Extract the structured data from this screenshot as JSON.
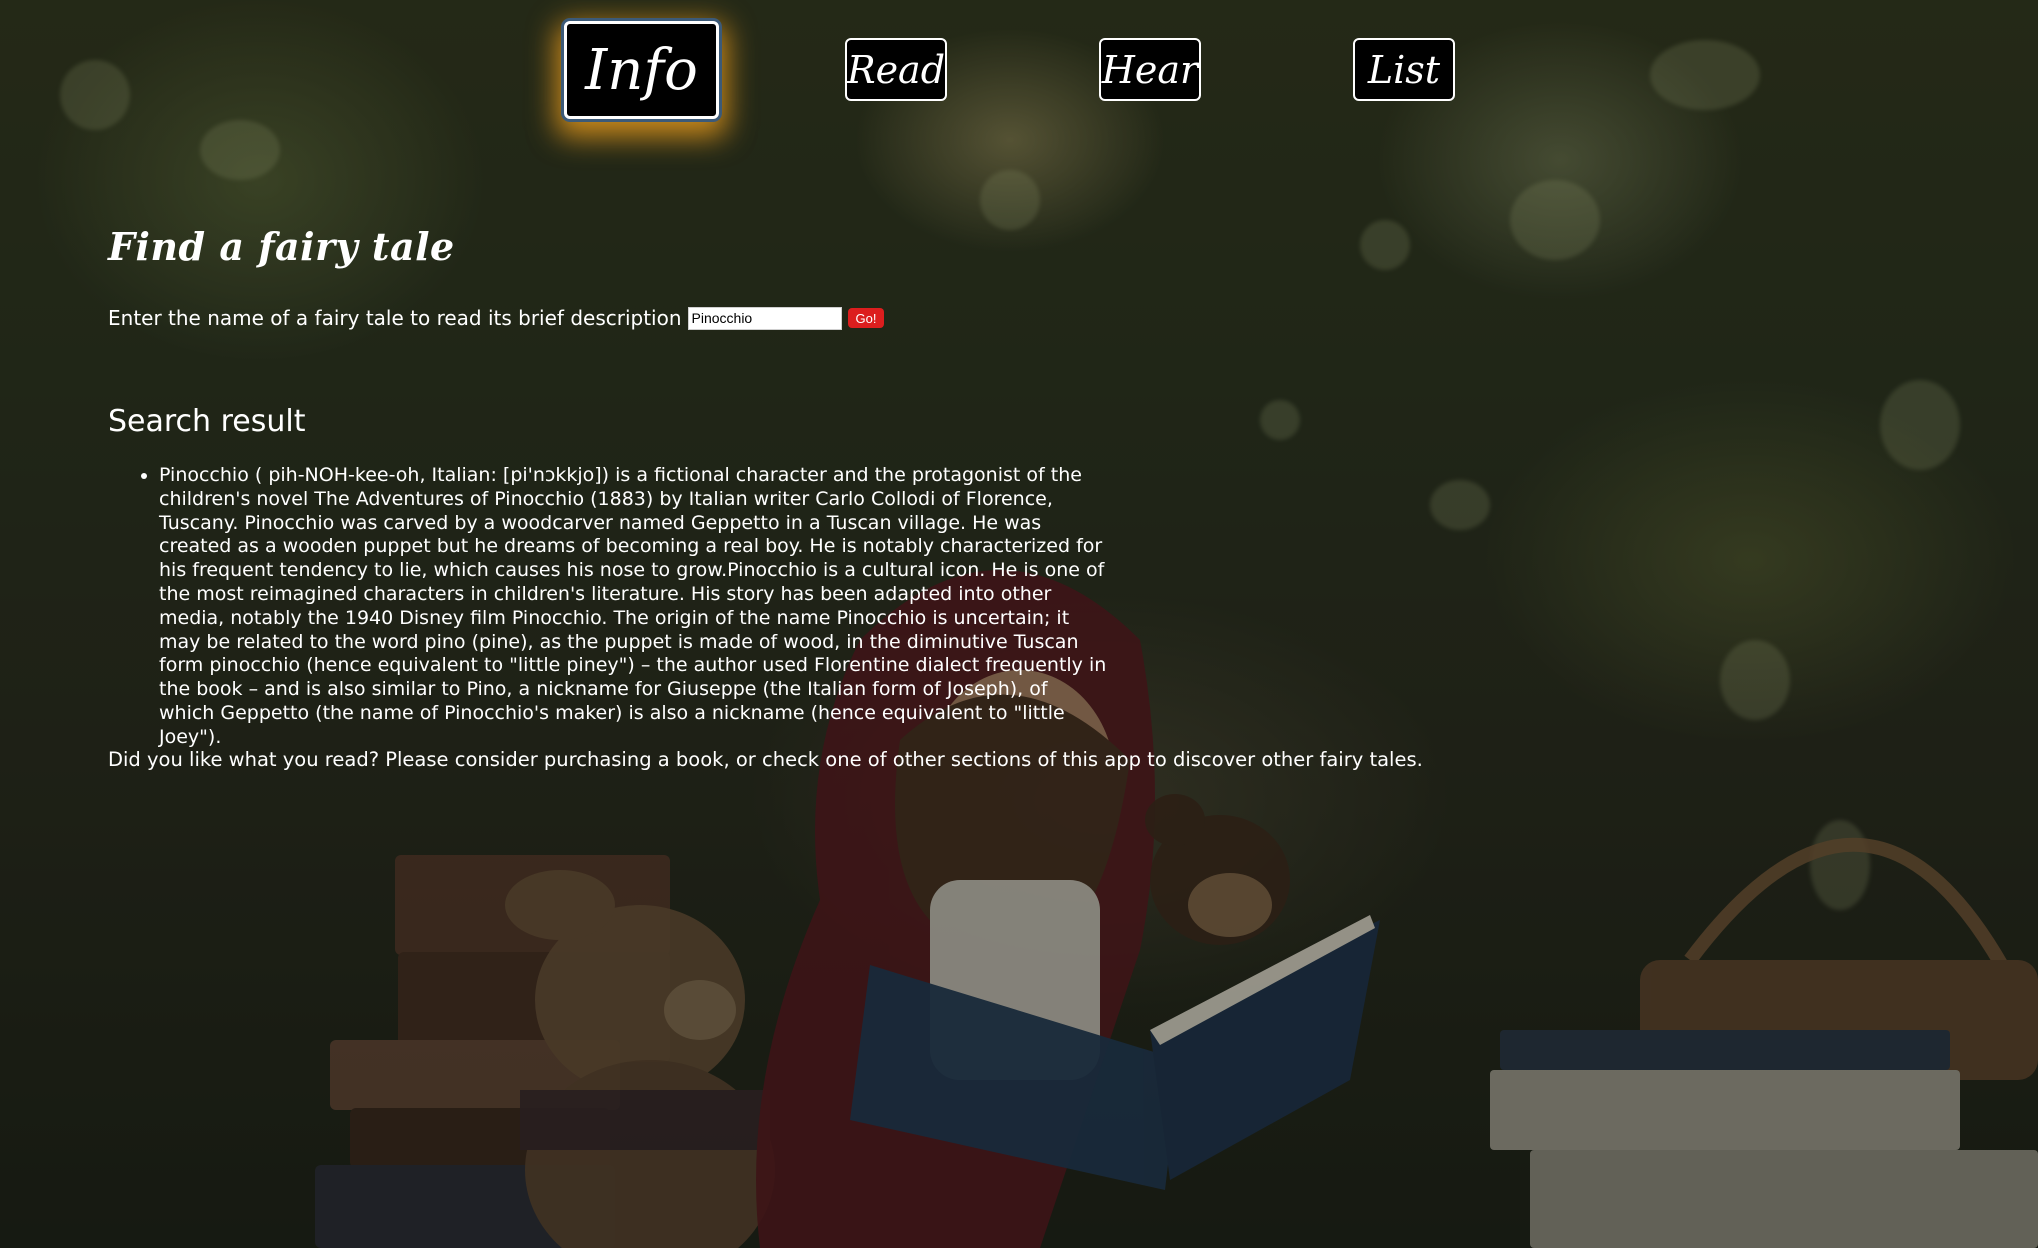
{
  "nav": {
    "items": [
      {
        "label": "Info",
        "active": true
      },
      {
        "label": "Read",
        "active": false
      },
      {
        "label": "Hear",
        "active": false
      },
      {
        "label": "List",
        "active": false
      }
    ]
  },
  "search": {
    "title": "Find a fairy tale",
    "label": "Enter the name of a fairy tale to read its brief description",
    "input_value": "Pinocchio",
    "button_label": "Go!"
  },
  "result": {
    "heading": "Search result",
    "items": [
      "Pinocchio ( pih-NOH-kee-oh, Italian: [pi'nɔkkjo]) is a fictional character and the protagonist of the children's novel The Adventures of Pinocchio (1883) by Italian writer Carlo Collodi of Florence, Tuscany. Pinocchio was carved by a woodcarver named Geppetto in a Tuscan village. He was created as a wooden puppet but he dreams of becoming a real boy. He is notably characterized for his frequent tendency to lie, which causes his nose to grow.Pinocchio is a cultural icon. He is one of the most reimagined characters in children's literature. His story has been adapted into other media, notably the 1940 Disney film Pinocchio. The origin of the name Pinocchio is uncertain; it may be related to the word pino (pine), as the puppet is made of wood, in the diminutive Tuscan form pinocchio (hence equivalent to \"little piney\") – the author used Florentine dialect frequently in the book – and is also similar to Pino, a nickname for Giuseppe (the Italian form of Joseph), of which Geppetto (the name of Pinocchio's maker) is also a nickname (hence equivalent to \"little Joey\")."
    ],
    "closing": "Did you like what you read? Please consider purchasing a book, or check one of other sections of this app to discover other fairy tales."
  },
  "colors": {
    "go_button": "#dc1e1e",
    "active_glow": "#ffa81e",
    "nav_background": "#000000"
  }
}
